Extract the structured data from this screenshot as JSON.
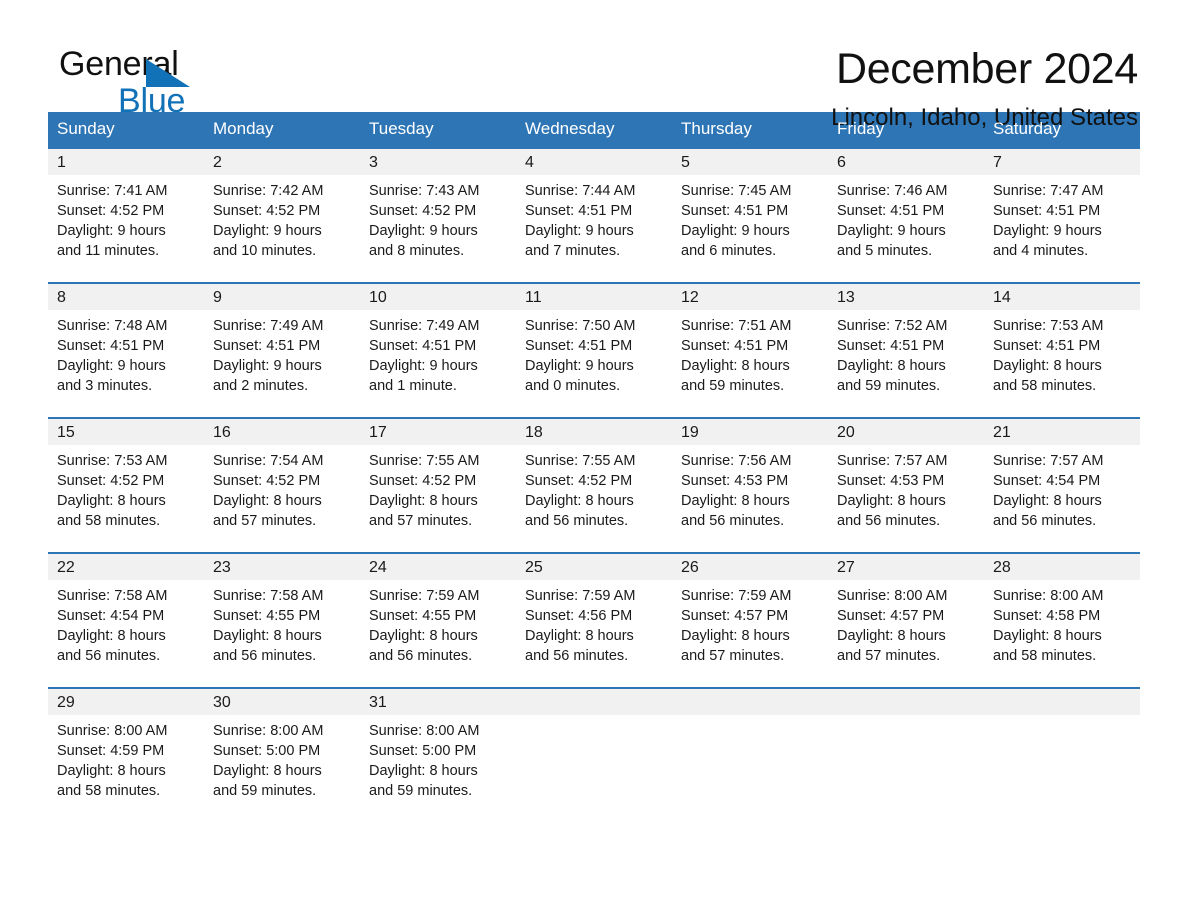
{
  "brand": {
    "name_part1": "General",
    "name_part2": "Blue",
    "triangle_color": "#1272B8"
  },
  "header": {
    "title": "December 2024",
    "location": "Lincoln, Idaho, United States"
  },
  "theme": {
    "header_blue": "#2E75B6",
    "daynum_band": "#F1F1F1",
    "text": "#1a1a1a"
  },
  "calendar": {
    "weekday_headers": [
      "Sunday",
      "Monday",
      "Tuesday",
      "Wednesday",
      "Thursday",
      "Friday",
      "Saturday"
    ],
    "weeks": [
      [
        {
          "day": "1",
          "sunrise": "Sunrise: 7:41 AM",
          "sunset": "Sunset: 4:52 PM",
          "daylight_line1": "Daylight: 9 hours",
          "daylight_line2": "and 11 minutes."
        },
        {
          "day": "2",
          "sunrise": "Sunrise: 7:42 AM",
          "sunset": "Sunset: 4:52 PM",
          "daylight_line1": "Daylight: 9 hours",
          "daylight_line2": "and 10 minutes."
        },
        {
          "day": "3",
          "sunrise": "Sunrise: 7:43 AM",
          "sunset": "Sunset: 4:52 PM",
          "daylight_line1": "Daylight: 9 hours",
          "daylight_line2": "and 8 minutes."
        },
        {
          "day": "4",
          "sunrise": "Sunrise: 7:44 AM",
          "sunset": "Sunset: 4:51 PM",
          "daylight_line1": "Daylight: 9 hours",
          "daylight_line2": "and 7 minutes."
        },
        {
          "day": "5",
          "sunrise": "Sunrise: 7:45 AM",
          "sunset": "Sunset: 4:51 PM",
          "daylight_line1": "Daylight: 9 hours",
          "daylight_line2": "and 6 minutes."
        },
        {
          "day": "6",
          "sunrise": "Sunrise: 7:46 AM",
          "sunset": "Sunset: 4:51 PM",
          "daylight_line1": "Daylight: 9 hours",
          "daylight_line2": "and 5 minutes."
        },
        {
          "day": "7",
          "sunrise": "Sunrise: 7:47 AM",
          "sunset": "Sunset: 4:51 PM",
          "daylight_line1": "Daylight: 9 hours",
          "daylight_line2": "and 4 minutes."
        }
      ],
      [
        {
          "day": "8",
          "sunrise": "Sunrise: 7:48 AM",
          "sunset": "Sunset: 4:51 PM",
          "daylight_line1": "Daylight: 9 hours",
          "daylight_line2": "and 3 minutes."
        },
        {
          "day": "9",
          "sunrise": "Sunrise: 7:49 AM",
          "sunset": "Sunset: 4:51 PM",
          "daylight_line1": "Daylight: 9 hours",
          "daylight_line2": "and 2 minutes."
        },
        {
          "day": "10",
          "sunrise": "Sunrise: 7:49 AM",
          "sunset": "Sunset: 4:51 PM",
          "daylight_line1": "Daylight: 9 hours",
          "daylight_line2": "and 1 minute."
        },
        {
          "day": "11",
          "sunrise": "Sunrise: 7:50 AM",
          "sunset": "Sunset: 4:51 PM",
          "daylight_line1": "Daylight: 9 hours",
          "daylight_line2": "and 0 minutes."
        },
        {
          "day": "12",
          "sunrise": "Sunrise: 7:51 AM",
          "sunset": "Sunset: 4:51 PM",
          "daylight_line1": "Daylight: 8 hours",
          "daylight_line2": "and 59 minutes."
        },
        {
          "day": "13",
          "sunrise": "Sunrise: 7:52 AM",
          "sunset": "Sunset: 4:51 PM",
          "daylight_line1": "Daylight: 8 hours",
          "daylight_line2": "and 59 minutes."
        },
        {
          "day": "14",
          "sunrise": "Sunrise: 7:53 AM",
          "sunset": "Sunset: 4:51 PM",
          "daylight_line1": "Daylight: 8 hours",
          "daylight_line2": "and 58 minutes."
        }
      ],
      [
        {
          "day": "15",
          "sunrise": "Sunrise: 7:53 AM",
          "sunset": "Sunset: 4:52 PM",
          "daylight_line1": "Daylight: 8 hours",
          "daylight_line2": "and 58 minutes."
        },
        {
          "day": "16",
          "sunrise": "Sunrise: 7:54 AM",
          "sunset": "Sunset: 4:52 PM",
          "daylight_line1": "Daylight: 8 hours",
          "daylight_line2": "and 57 minutes."
        },
        {
          "day": "17",
          "sunrise": "Sunrise: 7:55 AM",
          "sunset": "Sunset: 4:52 PM",
          "daylight_line1": "Daylight: 8 hours",
          "daylight_line2": "and 57 minutes."
        },
        {
          "day": "18",
          "sunrise": "Sunrise: 7:55 AM",
          "sunset": "Sunset: 4:52 PM",
          "daylight_line1": "Daylight: 8 hours",
          "daylight_line2": "and 56 minutes."
        },
        {
          "day": "19",
          "sunrise": "Sunrise: 7:56 AM",
          "sunset": "Sunset: 4:53 PM",
          "daylight_line1": "Daylight: 8 hours",
          "daylight_line2": "and 56 minutes."
        },
        {
          "day": "20",
          "sunrise": "Sunrise: 7:57 AM",
          "sunset": "Sunset: 4:53 PM",
          "daylight_line1": "Daylight: 8 hours",
          "daylight_line2": "and 56 minutes."
        },
        {
          "day": "21",
          "sunrise": "Sunrise: 7:57 AM",
          "sunset": "Sunset: 4:54 PM",
          "daylight_line1": "Daylight: 8 hours",
          "daylight_line2": "and 56 minutes."
        }
      ],
      [
        {
          "day": "22",
          "sunrise": "Sunrise: 7:58 AM",
          "sunset": "Sunset: 4:54 PM",
          "daylight_line1": "Daylight: 8 hours",
          "daylight_line2": "and 56 minutes."
        },
        {
          "day": "23",
          "sunrise": "Sunrise: 7:58 AM",
          "sunset": "Sunset: 4:55 PM",
          "daylight_line1": "Daylight: 8 hours",
          "daylight_line2": "and 56 minutes."
        },
        {
          "day": "24",
          "sunrise": "Sunrise: 7:59 AM",
          "sunset": "Sunset: 4:55 PM",
          "daylight_line1": "Daylight: 8 hours",
          "daylight_line2": "and 56 minutes."
        },
        {
          "day": "25",
          "sunrise": "Sunrise: 7:59 AM",
          "sunset": "Sunset: 4:56 PM",
          "daylight_line1": "Daylight: 8 hours",
          "daylight_line2": "and 56 minutes."
        },
        {
          "day": "26",
          "sunrise": "Sunrise: 7:59 AM",
          "sunset": "Sunset: 4:57 PM",
          "daylight_line1": "Daylight: 8 hours",
          "daylight_line2": "and 57 minutes."
        },
        {
          "day": "27",
          "sunrise": "Sunrise: 8:00 AM",
          "sunset": "Sunset: 4:57 PM",
          "daylight_line1": "Daylight: 8 hours",
          "daylight_line2": "and 57 minutes."
        },
        {
          "day": "28",
          "sunrise": "Sunrise: 8:00 AM",
          "sunset": "Sunset: 4:58 PM",
          "daylight_line1": "Daylight: 8 hours",
          "daylight_line2": "and 58 minutes."
        }
      ],
      [
        {
          "day": "29",
          "sunrise": "Sunrise: 8:00 AM",
          "sunset": "Sunset: 4:59 PM",
          "daylight_line1": "Daylight: 8 hours",
          "daylight_line2": "and 58 minutes."
        },
        {
          "day": "30",
          "sunrise": "Sunrise: 8:00 AM",
          "sunset": "Sunset: 5:00 PM",
          "daylight_line1": "Daylight: 8 hours",
          "daylight_line2": "and 59 minutes."
        },
        {
          "day": "31",
          "sunrise": "Sunrise: 8:00 AM",
          "sunset": "Sunset: 5:00 PM",
          "daylight_line1": "Daylight: 8 hours",
          "daylight_line2": "and 59 minutes."
        },
        {
          "day": "",
          "sunrise": "",
          "sunset": "",
          "daylight_line1": "",
          "daylight_line2": ""
        },
        {
          "day": "",
          "sunrise": "",
          "sunset": "",
          "daylight_line1": "",
          "daylight_line2": ""
        },
        {
          "day": "",
          "sunrise": "",
          "sunset": "",
          "daylight_line1": "",
          "daylight_line2": ""
        },
        {
          "day": "",
          "sunrise": "",
          "sunset": "",
          "daylight_line1": "",
          "daylight_line2": ""
        }
      ]
    ]
  }
}
